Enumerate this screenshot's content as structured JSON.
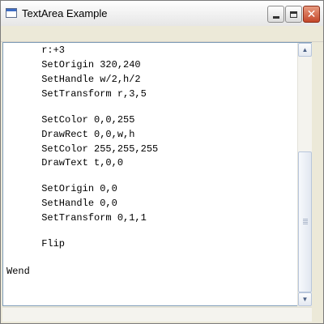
{
  "window": {
    "title": "TextArea Example"
  },
  "titlebar_buttons": {
    "minimize": "minimize-icon",
    "maximize": "maximize-icon",
    "close": "close-icon"
  },
  "textarea": {
    "lines": [
      "      r:+3",
      "      SetOrigin 320,240",
      "      SetHandle w/2,h/2",
      "      SetTransform r,3,5",
      "",
      "      SetColor 0,0,255",
      "      DrawRect 0,0,w,h",
      "      SetColor 255,255,255",
      "      DrawText t,0,0",
      "",
      "      SetOrigin 0,0",
      "      SetHandle 0,0",
      "      SetTransform 0,1,1",
      "",
      "      Flip",
      "",
      "Wend"
    ]
  },
  "scrollbar": {
    "up_icon": "scroll-up-arrow-icon",
    "down_icon": "scroll-down-arrow-icon",
    "vertical_scroll_fraction": 0.75
  },
  "colors": {
    "textarea_border": "#7F9DB9",
    "window_background": "#ECE9D8",
    "close_button": "#C4472A"
  }
}
